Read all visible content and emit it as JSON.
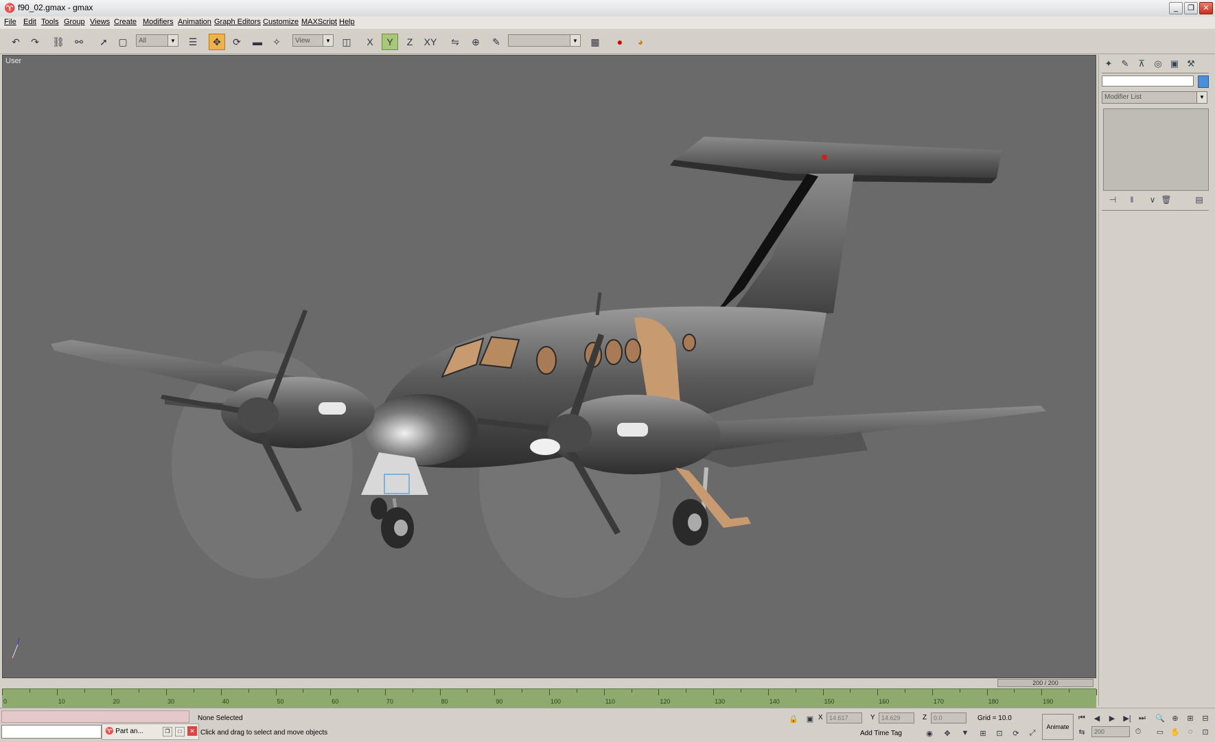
{
  "window": {
    "title": "f90_02.gmax - gmax"
  },
  "menu": [
    "File",
    "Edit",
    "Tools",
    "Group",
    "Views",
    "Create",
    "Modifiers",
    "Animation",
    "Graph Editors",
    "Customize",
    "MAXScript",
    "Help"
  ],
  "toolbar": {
    "selection_filter": "All",
    "ref_coord": "View",
    "named_selection": ""
  },
  "viewport": {
    "label": "User"
  },
  "command_panel": {
    "object_name": "",
    "modifier_list": "Modifier List",
    "object_color": "#4a8fdc"
  },
  "time_slider": {
    "label": "200 / 200"
  },
  "ruler": {
    "ticks": [
      "0",
      "10",
      "20",
      "30",
      "40",
      "50",
      "60",
      "70",
      "80",
      "90",
      "100",
      "110",
      "120",
      "130",
      "140",
      "150",
      "160",
      "170",
      "180",
      "190"
    ]
  },
  "status": {
    "selection": "None Selected",
    "prompt": "Click and drag to select and move objects",
    "x_label": "X",
    "y_label": "Y",
    "z_label": "Z",
    "x": "14.617",
    "y": "14.629",
    "z": "0.0",
    "grid": "Grid = 10.0",
    "add_time_tag": "Add Time Tag",
    "animate": "Animate",
    "frame": "200"
  },
  "taskbar": {
    "label": "Part an..."
  },
  "colors": {
    "viewport_bg": "#6a6a6a",
    "ruler": "#8faa6e",
    "accent_active": "#f0b14a",
    "copper": "#c89a70"
  }
}
